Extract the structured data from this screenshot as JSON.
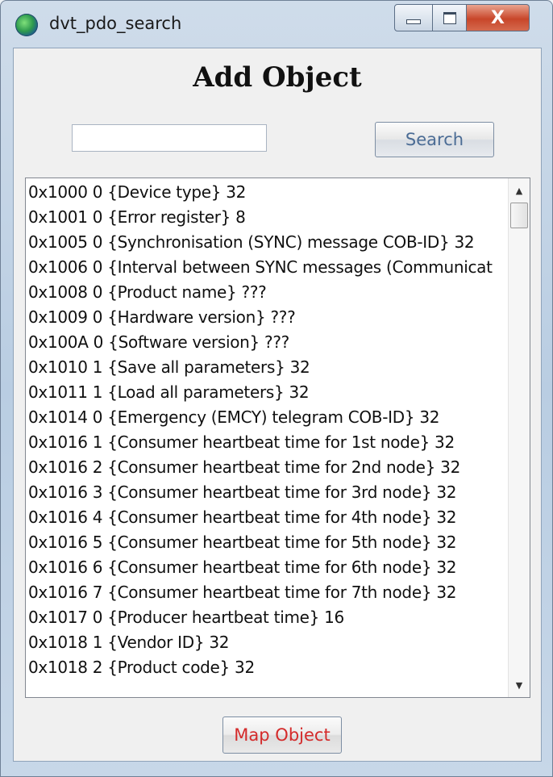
{
  "window": {
    "title": "dvt_pdo_search",
    "close_glyph": "X",
    "app_icon": "globe-icon"
  },
  "dialog": {
    "heading": "Add Object",
    "search": {
      "value": "",
      "placeholder": ""
    },
    "search_button_label": "Search",
    "map_button_label": "Map Object",
    "map_button_color": "#d42a2a",
    "search_button_color": "#4b6c95"
  },
  "objects": [
    "0x1000 0 {Device type} 32",
    "0x1001 0 {Error register} 8",
    "0x1005 0 {Synchronisation (SYNC) message COB-ID} 32",
    "0x1006 0 {Interval between SYNC messages (Communicat",
    "0x1008 0 {Product name} ???",
    "0x1009 0 {Hardware version} ???",
    "0x100A 0 {Software version} ???",
    "0x1010 1 {Save all parameters} 32",
    "0x1011 1 {Load all parameters} 32",
    "0x1014 0 {Emergency (EMCY) telegram COB-ID} 32",
    "0x1016 1 {Consumer heartbeat time for 1st node} 32",
    "0x1016 2 {Consumer heartbeat time for 2nd node} 32",
    "0x1016 3 {Consumer heartbeat time for 3rd node} 32",
    "0x1016 4 {Consumer heartbeat time for 4th node} 32",
    "0x1016 5 {Consumer heartbeat time for 5th node} 32",
    "0x1016 6 {Consumer heartbeat time for 6th node} 32",
    "0x1016 7 {Consumer heartbeat time for 7th node} 32",
    "0x1017 0 {Producer heartbeat time} 16",
    "0x1018 1 {Vendor ID} 32",
    "0x1018 2 {Product code} 32"
  ]
}
